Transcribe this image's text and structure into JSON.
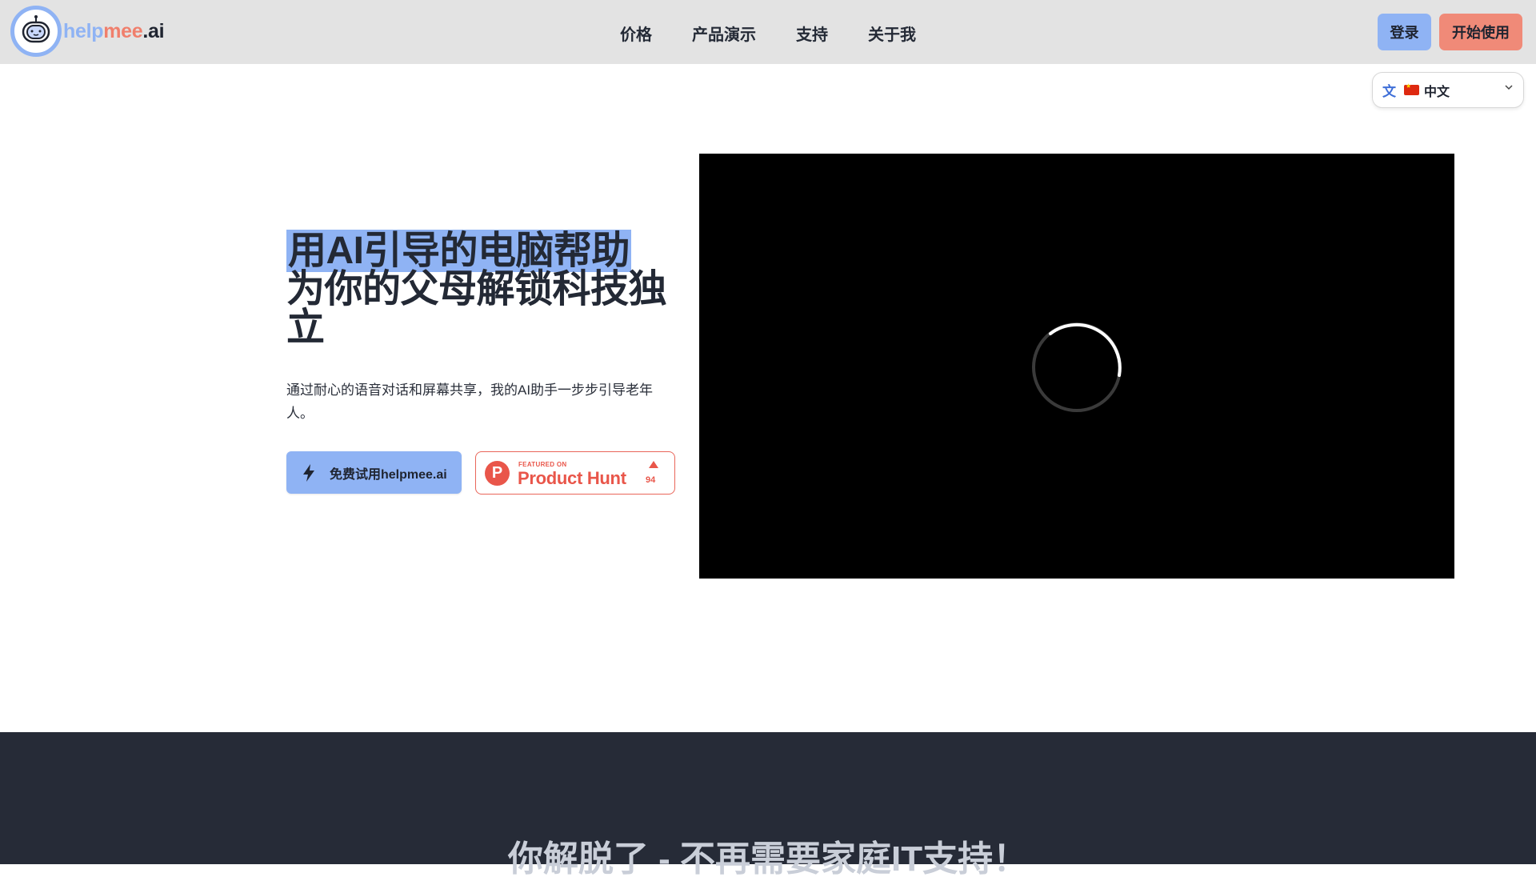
{
  "header": {
    "logo": {
      "icon": "robot-icon",
      "part1": "help",
      "part2": "mee",
      "part3": ".ai"
    },
    "nav": [
      {
        "label": "价格"
      },
      {
        "label": "产品演示"
      },
      {
        "label": "支持"
      },
      {
        "label": "关于我"
      }
    ],
    "login_label": "登录",
    "start_label": "开始使用"
  },
  "language_selector": {
    "icon": "translate-icon",
    "flag": "cn-flag",
    "selected": "中文"
  },
  "hero": {
    "title_highlight": "用AI引导的电脑帮助",
    "title_rest": "为你的父母解锁科技独立",
    "subtitle": "通过耐心的语音对话和屏幕共享，我的AI助手一步步引导老年人。",
    "cta_label": "免费试用helpmee.ai",
    "cta_icon": "bolt-icon",
    "product_hunt": {
      "featured": "FEATURED ON",
      "name": "Product Hunt",
      "upvotes": "94",
      "logo_letter": "P"
    }
  },
  "video": {
    "state": "loading"
  },
  "section2": {
    "title": "你解脱了 - 不再需要家庭IT支持！"
  },
  "colors": {
    "accent_blue": "#8fb3f4",
    "accent_coral": "#f08a78",
    "dark_bg": "#262b37",
    "ph_red": "#e9564a"
  }
}
